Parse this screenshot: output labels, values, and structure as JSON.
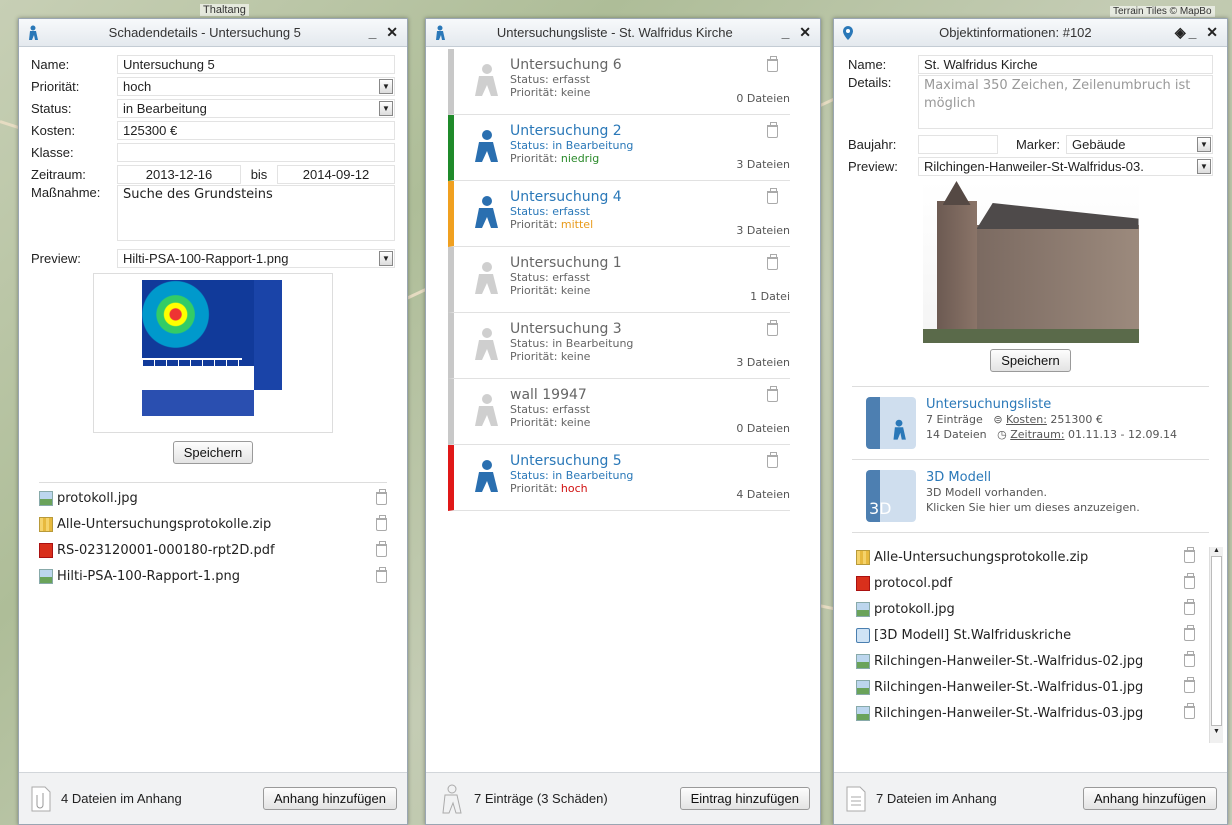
{
  "map": {
    "label_top": "Thaltang",
    "attribution": "Terrain Tiles © MapBo"
  },
  "panel1": {
    "title": "Schadendetails - Untersuchung 5",
    "controls": "_ ✕",
    "fields": {
      "name_label": "Name:",
      "name": "Untersuchung 5",
      "prio_label": "Priorität:",
      "prio": "hoch",
      "status_label": "Status:",
      "status": "in Bearbeitung",
      "kosten_label": "Kosten:",
      "kosten": "125300 €",
      "klasse_label": "Klasse:",
      "klasse": "",
      "zeitraum_label": "Zeitraum:",
      "von": "2013-12-16",
      "bis_label": "bis",
      "bis": "2014-09-12",
      "massnahme_label": "Maßnahme:",
      "massnahme": "Suche des Grundsteins",
      "preview_label": "Preview:",
      "preview": "Hilti-PSA-100-Rapport-1.png"
    },
    "save_label": "Speichern",
    "files": [
      {
        "name": "protokoll.jpg",
        "icon": "image-file-icon"
      },
      {
        "name": "Alle-Untersuchungsprotokolle.zip",
        "icon": "zip-file-icon"
      },
      {
        "name": "RS-023120001-000180-rpt2D.pdf",
        "icon": "pdf-file-icon"
      },
      {
        "name": "Hilti-PSA-100-Rapport-1.png",
        "icon": "image-file-icon"
      }
    ],
    "footer_text": "4 Dateien im Anhang",
    "footer_button": "Anhang hinzufügen"
  },
  "panel2": {
    "title": "Untersuchungsliste - St. Walfridus Kirche",
    "controls": "_ ✕",
    "items": [
      {
        "name": "Untersuchung 6",
        "status": "Status: erfasst",
        "prio_prefix": "Priorität: ",
        "prio": "keine",
        "files": "0 Dateien",
        "color": "#c8c8c8",
        "prio_color": "#666666",
        "active": false
      },
      {
        "name": "Untersuchung 2",
        "status": "Status: in Bearbeitung",
        "prio_prefix": "Priorität: ",
        "prio": "niedrig",
        "files": "3 Dateien",
        "color": "#1f8a2a",
        "prio_color": "#2a8a2a",
        "active": true
      },
      {
        "name": "Untersuchung 4",
        "status": "Status: erfasst",
        "prio_prefix": "Priorität: ",
        "prio": "mittel",
        "files": "3 Dateien",
        "color": "#f0a020",
        "prio_color": "#e89a1a",
        "active": true
      },
      {
        "name": "Untersuchung 1",
        "status": "Status: erfasst",
        "prio_prefix": "Priorität: ",
        "prio": "keine",
        "files": "1 Datei",
        "color": "#c8c8c8",
        "prio_color": "#666666",
        "active": false
      },
      {
        "name": "Untersuchung 3",
        "status": "Status: in Bearbeitung",
        "prio_prefix": "Priorität: ",
        "prio": "keine",
        "files": "3 Dateien",
        "color": "#c8c8c8",
        "prio_color": "#666666",
        "active": false
      },
      {
        "name": "wall 19947",
        "status": "Status: erfasst",
        "prio_prefix": "Priorität: ",
        "prio": "keine",
        "files": "0 Dateien",
        "color": "#c8c8c8",
        "prio_color": "#666666",
        "active": false
      },
      {
        "name": "Untersuchung 5",
        "status": "Status: in Bearbeitung",
        "prio_prefix": "Priorität: ",
        "prio": "hoch",
        "files": "4 Dateien",
        "color": "#e01818",
        "prio_color": "#d01010",
        "active": true
      }
    ],
    "footer_text": "7 Einträge (3 Schäden)",
    "footer_button": "Eintrag hinzufügen"
  },
  "panel3": {
    "title": "Objektinformationen: #102",
    "controls": "◈_ ✕",
    "fields": {
      "name_label": "Name:",
      "name": "St. Walfridus Kirche",
      "details_label": "Details:",
      "details_placeholder": "Maximal 350 Zeichen, Zeilenumbruch ist möglich",
      "baujahr_label": "Baujahr:",
      "baujahr": "",
      "marker_label": "Marker:",
      "marker": "Gebäude",
      "preview_label": "Preview:",
      "preview": "Rilchingen-Hanweiler-St-Walfridus-03."
    },
    "save_label": "Speichern",
    "card1": {
      "title": "Untersuchungsliste",
      "line1a": "7 Einträge",
      "kosten_label": "Kosten:",
      "kosten": "251300 €",
      "line2a": "14 Dateien",
      "zeitraum_label": "Zeitraum:",
      "zeitraum": "01.11.13 - 12.09.14"
    },
    "card2": {
      "title": "3D Modell",
      "line1": "3D Modell vorhanden.",
      "line2": "Klicken Sie hier um dieses anzuzeigen.",
      "badge": "3D"
    },
    "files": [
      {
        "name": "Alle-Untersuchungsprotokolle.zip",
        "icon": "zip-file-icon"
      },
      {
        "name": "protocol.pdf",
        "icon": "pdf-file-icon"
      },
      {
        "name": "protokoll.jpg",
        "icon": "image-file-icon"
      },
      {
        "name": "[3D Modell] St.Walfriduskriche",
        "icon": "3d-model-icon"
      },
      {
        "name": "Rilchingen-Hanweiler-St.-Walfridus-02.jpg",
        "icon": "image-file-icon"
      },
      {
        "name": "Rilchingen-Hanweiler-St.-Walfridus-01.jpg",
        "icon": "image-file-icon"
      },
      {
        "name": "Rilchingen-Hanweiler-St.-Walfridus-03.jpg",
        "icon": "image-file-icon"
      }
    ],
    "footer_text": "7 Dateien im Anhang",
    "footer_button": "Anhang hinzufügen"
  }
}
